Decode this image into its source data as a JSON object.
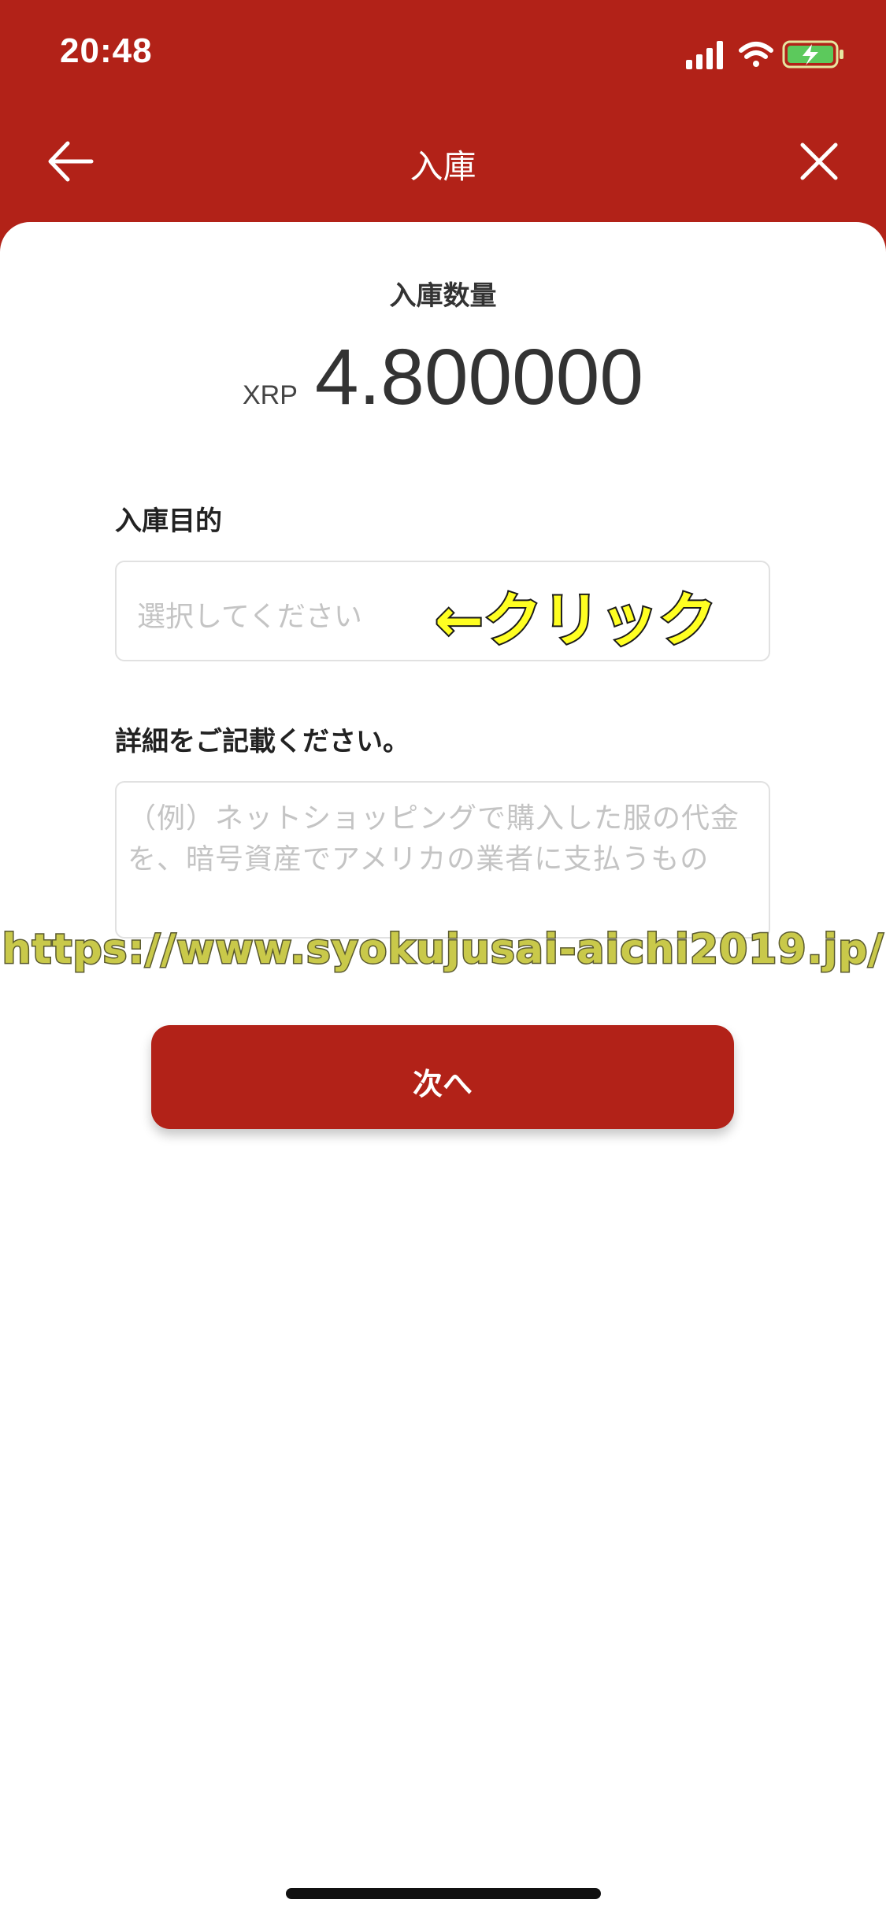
{
  "status_bar": {
    "time": "20:48",
    "icons": [
      "signal-icon",
      "wifi-icon",
      "battery-charging-icon"
    ]
  },
  "nav": {
    "title": "入庫",
    "back_icon": "arrow-left-icon",
    "close_icon": "close-icon"
  },
  "amount": {
    "label": "入庫数量",
    "unit": "XRP",
    "value": "4.800000"
  },
  "purpose": {
    "label": "入庫目的",
    "placeholder": "選択してください",
    "annotation": "←クリック"
  },
  "details": {
    "label": "詳細をご記載ください。",
    "placeholder": "（例）ネットショッピングで購入した服の代金を、暗号資産でアメリカの業者に支払うもの"
  },
  "watermark": "https://www.syokujusai-aichi2019.jp/",
  "next_button": {
    "label": "次へ"
  },
  "colors": {
    "brand_red": "#b22218",
    "annotation_yellow": "#ffff22",
    "placeholder_gray": "#c4c4c4"
  }
}
